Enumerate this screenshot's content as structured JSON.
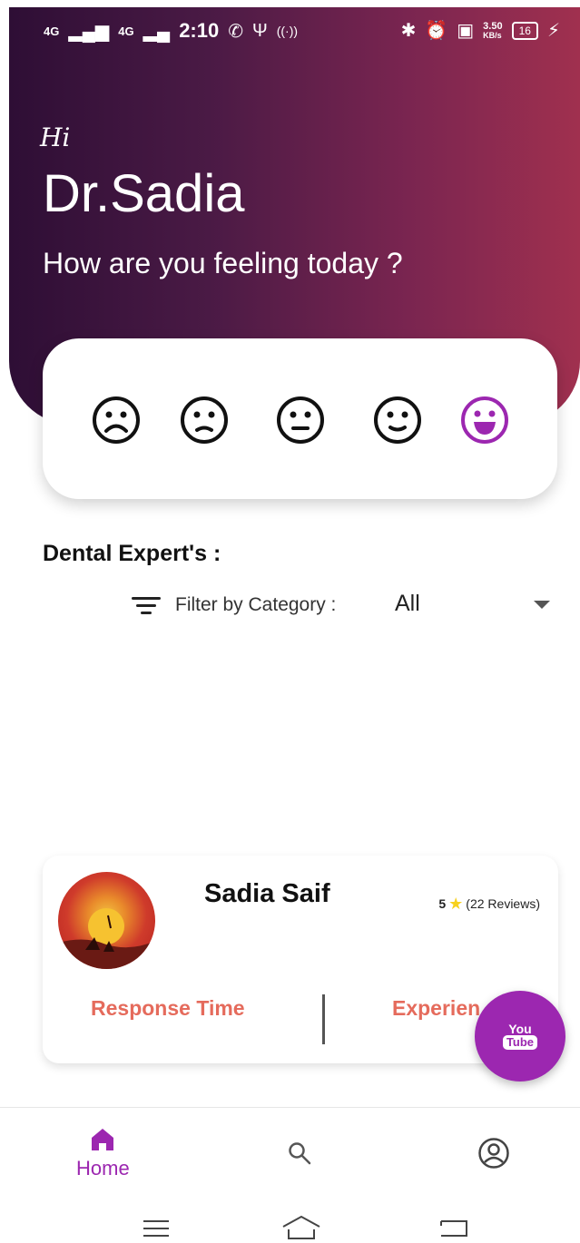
{
  "status_bar": {
    "network1": "4G",
    "network2": "4G",
    "time": "2:10",
    "speed": "3.50",
    "speed_unit": "KB/s",
    "battery": "16"
  },
  "greeting": {
    "hi": "Hi",
    "name": "Dr.Sadia",
    "question": "How are you feeling today ?"
  },
  "moods": [
    {
      "icon": "very-sad-face-icon"
    },
    {
      "icon": "sad-face-icon"
    },
    {
      "icon": "neutral-face-icon"
    },
    {
      "icon": "slight-smile-face-icon"
    },
    {
      "icon": "happy-face-icon",
      "selected": true,
      "color": "#9c27b0"
    }
  ],
  "experts": {
    "title": "Dental Expert's :",
    "filter_label": "Filter by Category :",
    "filter_value": "All"
  },
  "doctor_card": {
    "name": "Sadia Saif",
    "rating": "5",
    "reviews": "(22 Reviews)",
    "response_label": "Response Time",
    "experience_label": "Experien"
  },
  "fab": {
    "top": "You",
    "bottom": "Tube"
  },
  "bottom_nav": {
    "home_label": "Home"
  },
  "colors": {
    "accent": "#9c27b0",
    "header_start": "#2e0e35",
    "header_end": "#a0304f",
    "label": "#e56b5c"
  }
}
